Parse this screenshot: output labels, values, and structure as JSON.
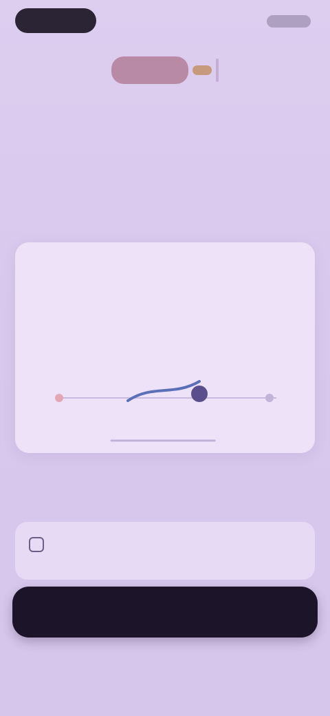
{
  "status_bar": {
    "time": "",
    "indicators": ""
  },
  "brand": {
    "logo_icon": "brand-logo-icon",
    "colors": {
      "mark": "#b98aa6",
      "accent": "#c79a7e"
    }
  },
  "header": {
    "title": "",
    "subtitle": ""
  },
  "preview_card": {
    "tag": "",
    "text": ""
  },
  "next_section": {
    "title": "",
    "item_icon": "checkbox-icon",
    "item_text": ""
  },
  "cta": {
    "label": ""
  },
  "footnote": {
    "text": ""
  },
  "colors": {
    "background": "#dccbee",
    "card": "#ede2f8",
    "button": "#1c1428",
    "chart_line": "#5a6fb8",
    "chart_point": "#5a4f8c"
  }
}
